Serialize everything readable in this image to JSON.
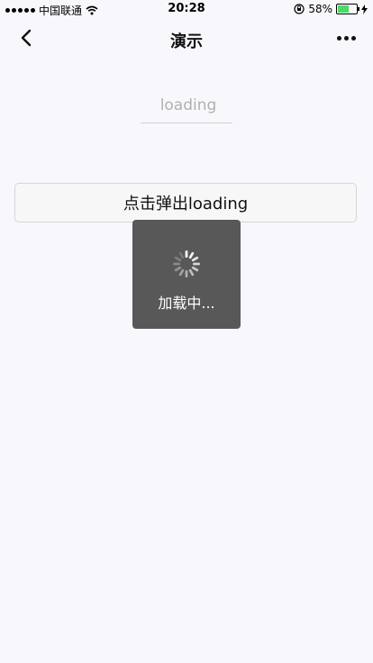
{
  "status_bar": {
    "carrier": "中国联通",
    "time": "20:28",
    "battery": "58%",
    "battery_level": 0.58
  },
  "nav": {
    "title": "演示",
    "back_icon": "chevron-left-icon",
    "more_icon": "more-dots-icon"
  },
  "input": {
    "placeholder": "loading"
  },
  "button": {
    "label": "点击弹出loading"
  },
  "toast": {
    "text": "加载中...",
    "icon": "spinner-icon"
  },
  "colors": {
    "background": "#f8f7fc",
    "toast_background": "#585858",
    "battery_fill": "#4cd964"
  }
}
